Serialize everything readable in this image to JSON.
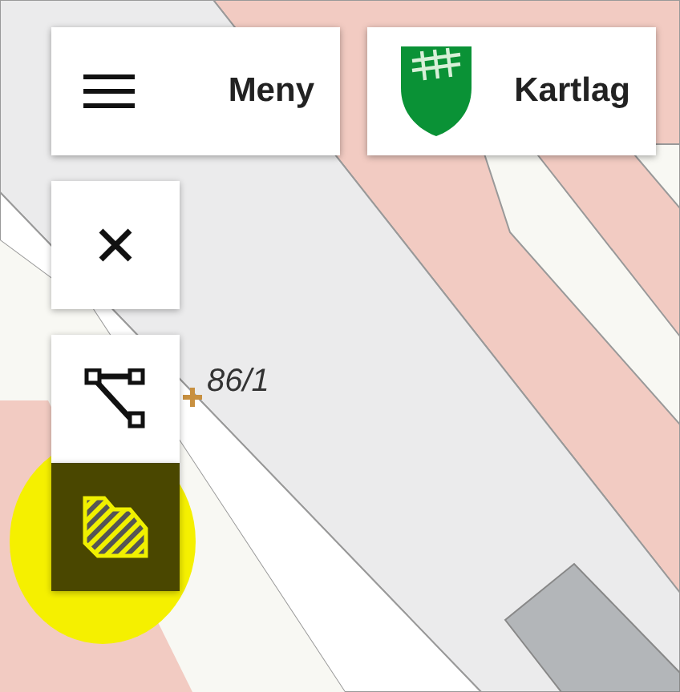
{
  "top_buttons": [
    {
      "kind": "menu",
      "label": "Meny"
    },
    {
      "kind": "layers",
      "label": "Kartlag"
    }
  ],
  "tools": [
    {
      "kind": "close",
      "selected": false
    },
    {
      "kind": "polyline",
      "selected": false
    },
    {
      "kind": "area",
      "selected": true
    }
  ],
  "map": {
    "parcel_label": "86/1"
  }
}
